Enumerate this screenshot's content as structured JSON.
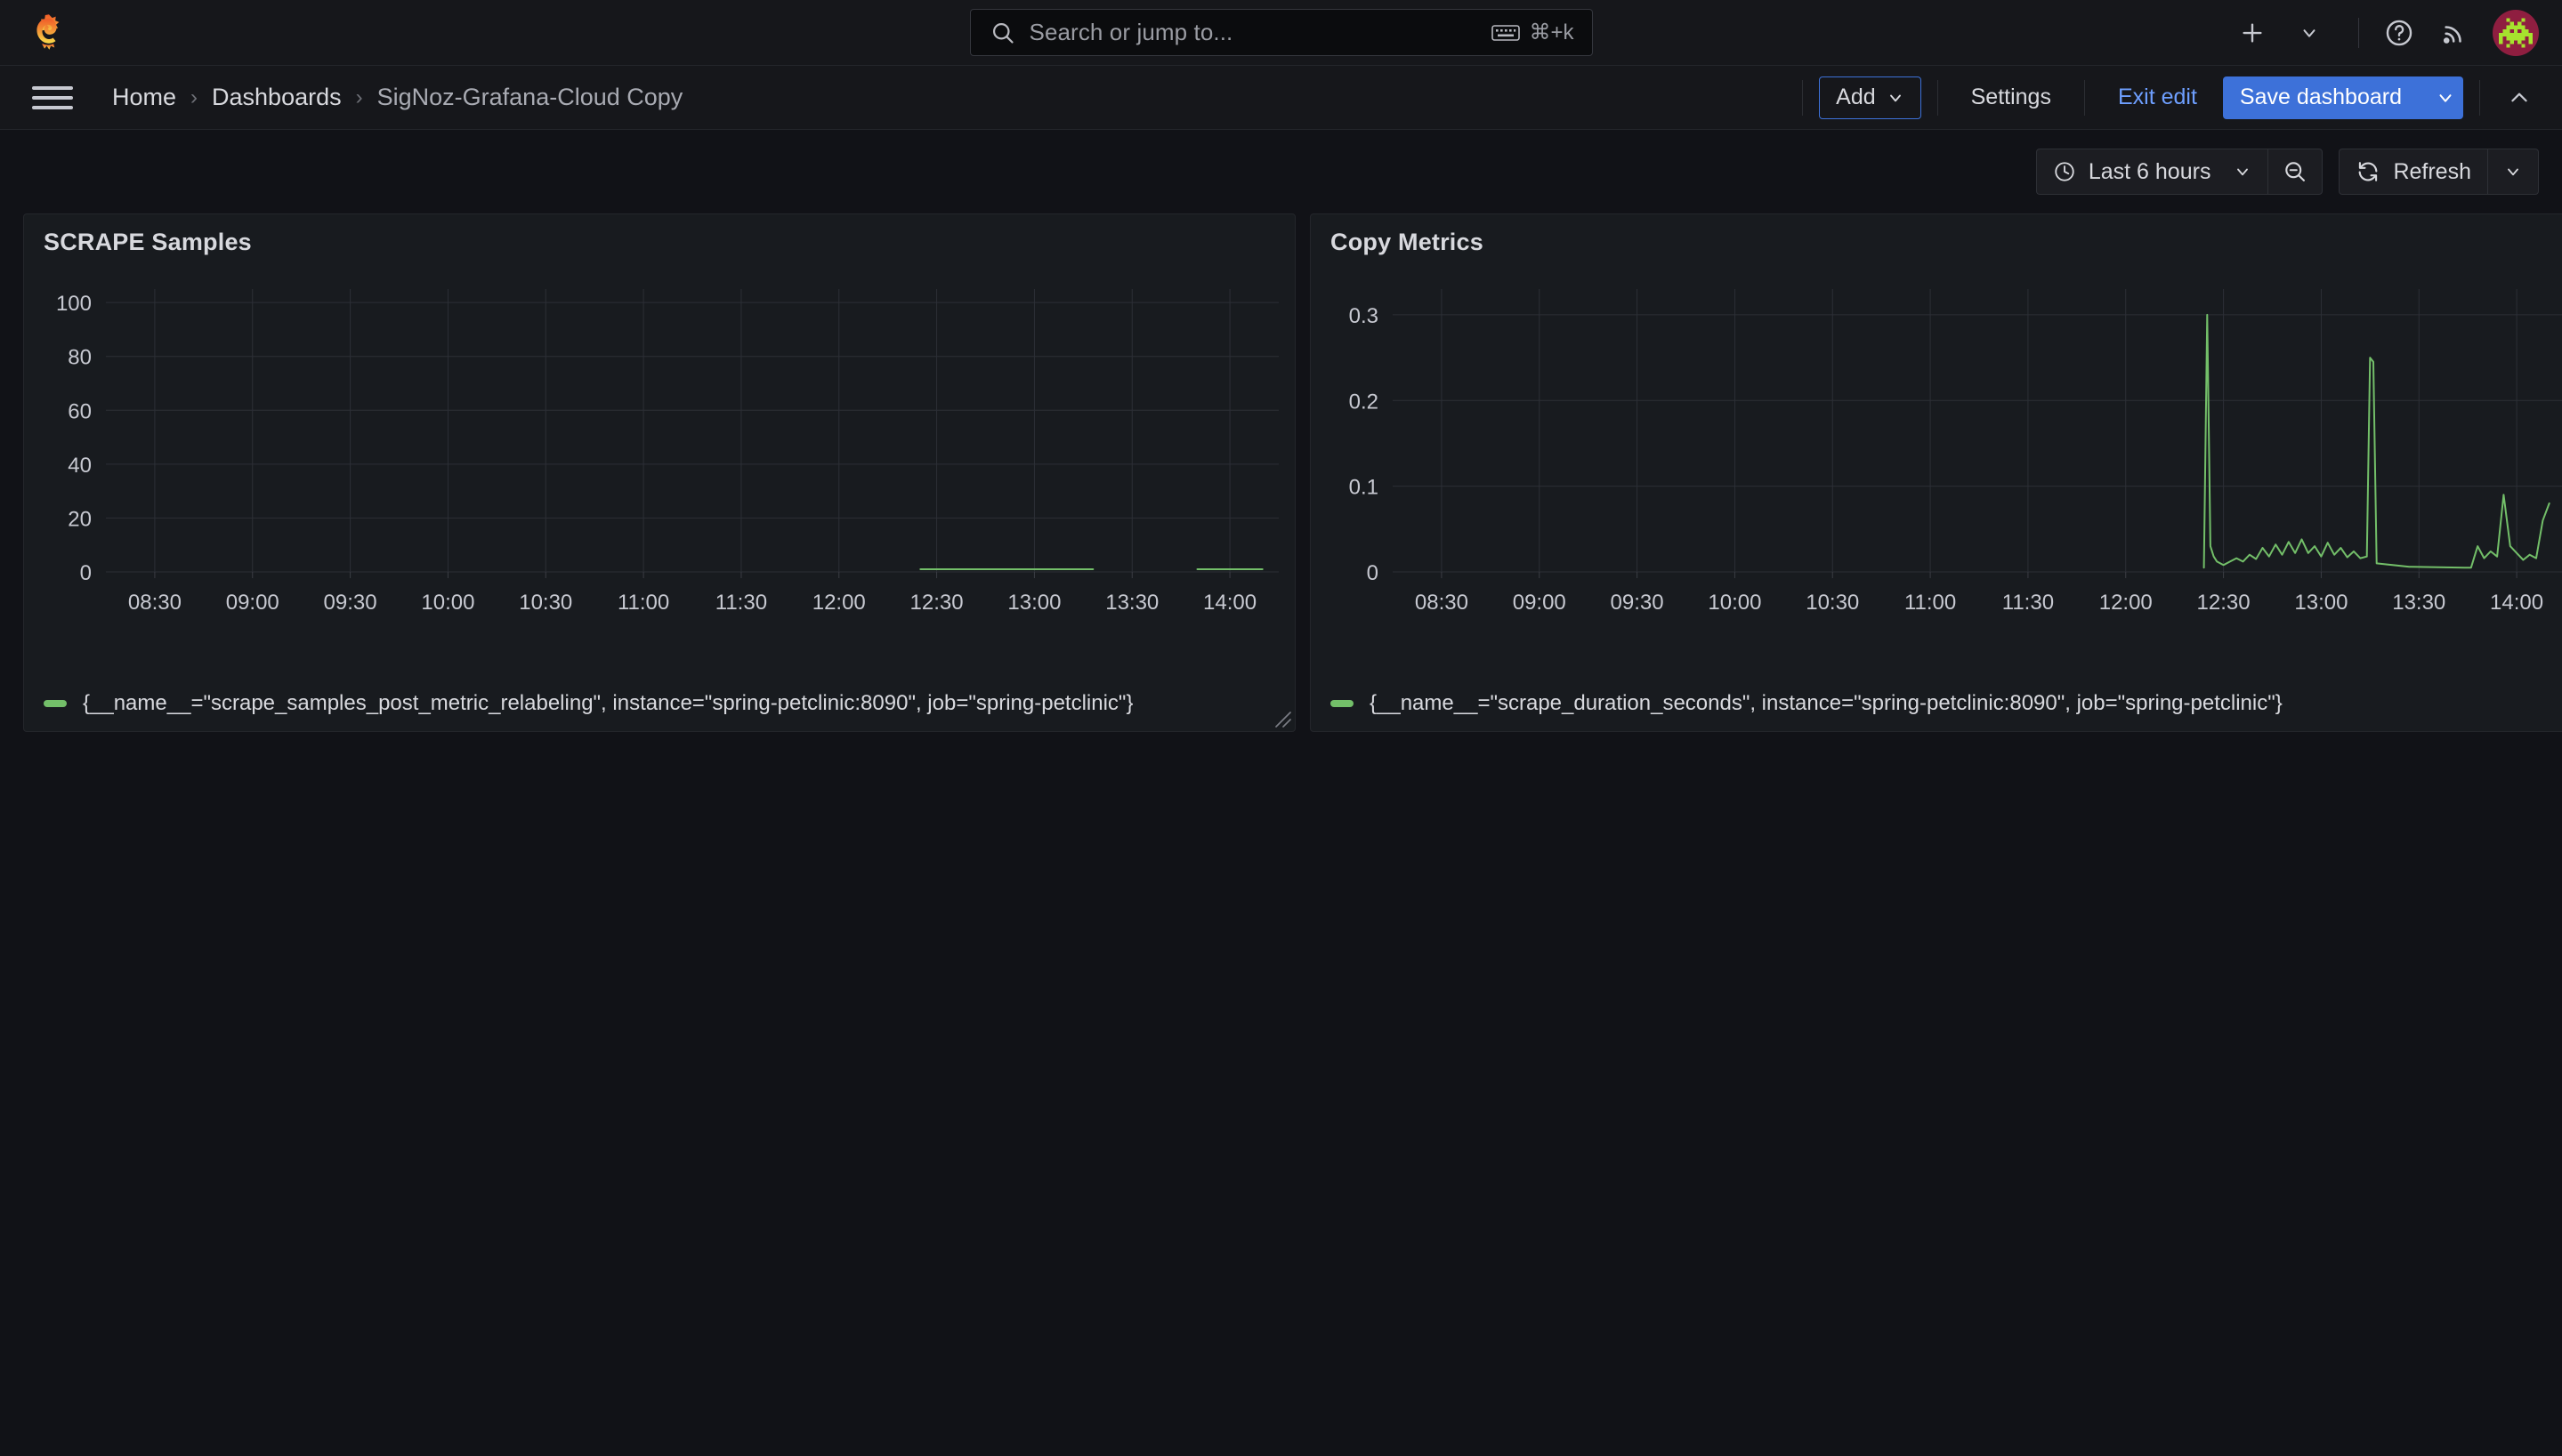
{
  "app": {
    "logo_icon": "grafana-logo-icon",
    "background": "#111217",
    "accent": "#3d71d9",
    "series_color": "#73bf69"
  },
  "search": {
    "placeholder": "Search or jump to...",
    "icon": "search-icon",
    "keyboard_icon": "keyboard-icon",
    "shortcut": "⌘+k"
  },
  "topnav": {
    "add_icon": "plus-icon",
    "add_chevron_icon": "chevron-down-icon",
    "help_icon": "help-circle-icon",
    "news_icon": "rss-icon",
    "avatar_icon": "user-avatar"
  },
  "breadcrumb": {
    "menu_icon": "hamburger-menu-icon",
    "items": [
      {
        "label": "Home"
      },
      {
        "label": "Dashboards"
      },
      {
        "label": "SigNoz-Grafana-Cloud Copy"
      }
    ],
    "separator": "›"
  },
  "toolbar": {
    "add_label": "Add",
    "add_chevron_icon": "chevron-down-icon",
    "settings_label": "Settings",
    "exit_edit_label": "Exit edit",
    "save_label": "Save dashboard",
    "save_chevron_icon": "chevron-down-icon",
    "collapse_icon": "chevron-up-icon"
  },
  "timebar": {
    "clock_icon": "clock-icon",
    "time_range": "Last 6 hours",
    "time_chevron_icon": "chevron-down-icon",
    "zoom_out_icon": "zoom-out-icon",
    "refresh_icon": "refresh-icon",
    "refresh_label": "Refresh",
    "refresh_chevron_icon": "chevron-down-icon"
  },
  "panels": [
    {
      "title": "SCRAPE Samples",
      "legend": "{__name__=\"scrape_samples_post_metric_relabeling\", instance=\"spring-petclinic:8090\", job=\"spring-petclinic\"}",
      "resize_icon": "resize-handle-icon"
    },
    {
      "title": "Copy Metrics",
      "legend": "{__name__=\"scrape_duration_seconds\", instance=\"spring-petclinic:8090\", job=\"spring-petclinic\"}",
      "resize_icon": "resize-handle-icon"
    }
  ],
  "chart_data": [
    {
      "type": "line",
      "title": "SCRAPE Samples",
      "xlabel": "",
      "ylabel": "",
      "grid": true,
      "legend_position": "bottom",
      "series": [
        {
          "name": "{__name__=\"scrape_samples_post_metric_relabeling\", instance=\"spring-petclinic:8090\", job=\"spring-petclinic\"}",
          "color": "#73bf69",
          "x": [
            "12:25",
            "12:30",
            "12:35",
            "12:40",
            "12:45",
            "12:50",
            "12:55",
            "13:00",
            "13:05",
            "13:10",
            "13:15",
            "13:18",
            "13:25",
            "13:27",
            "13:45",
            "13:50",
            "13:55",
            "14:00",
            "14:05",
            "14:10"
          ],
          "values": [
            1,
            1,
            1,
            1,
            1,
            1,
            1,
            1,
            1,
            1,
            1,
            1,
            null,
            1,
            null,
            1,
            1,
            1,
            1,
            1
          ]
        }
      ],
      "xticks": [
        "08:30",
        "09:00",
        "09:30",
        "10:00",
        "10:30",
        "11:00",
        "11:30",
        "12:00",
        "12:30",
        "13:00",
        "13:30",
        "14:00"
      ],
      "yticks": [
        0,
        20,
        40,
        60,
        80,
        100
      ],
      "ylim": [
        0,
        105
      ],
      "xlim": [
        "08:15",
        "14:15"
      ]
    },
    {
      "type": "line",
      "title": "Copy Metrics",
      "xlabel": "",
      "ylabel": "",
      "grid": true,
      "legend_position": "bottom",
      "series": [
        {
          "name": "{__name__=\"scrape_duration_seconds\", instance=\"spring-petclinic:8090\", job=\"spring-petclinic\"}",
          "color": "#73bf69",
          "x": [
            "12:24",
            "12:25",
            "12:26",
            "12:27",
            "12:28",
            "12:30",
            "12:32",
            "12:34",
            "12:36",
            "12:38",
            "12:40",
            "12:42",
            "12:44",
            "12:46",
            "12:48",
            "12:50",
            "12:52",
            "12:54",
            "12:56",
            "12:58",
            "13:00",
            "13:02",
            "13:04",
            "13:06",
            "13:08",
            "13:10",
            "13:12",
            "13:14",
            "13:15",
            "13:16",
            "13:17",
            "13:27",
            "13:28",
            "13:44",
            "13:46",
            "13:48",
            "13:50",
            "13:52",
            "13:54",
            "13:56",
            "13:58",
            "14:00",
            "14:02",
            "14:04",
            "14:06",
            "14:08",
            "14:10"
          ],
          "values": [
            0.005,
            0.3,
            0.03,
            0.018,
            0.012,
            0.008,
            0.012,
            0.016,
            0.012,
            0.02,
            0.015,
            0.028,
            0.018,
            0.032,
            0.02,
            0.035,
            0.022,
            0.038,
            0.022,
            0.03,
            0.018,
            0.034,
            0.02,
            0.028,
            0.017,
            0.024,
            0.016,
            0.018,
            0.25,
            0.245,
            0.01,
            0.006,
            0.006,
            0.005,
            0.005,
            0.03,
            0.016,
            0.024,
            0.018,
            0.09,
            0.03,
            0.022,
            0.014,
            0.02,
            0.016,
            0.06,
            0.08
          ]
        }
      ],
      "xticks": [
        "08:30",
        "09:00",
        "09:30",
        "10:00",
        "10:30",
        "11:00",
        "11:30",
        "12:00",
        "12:30",
        "13:00",
        "13:30",
        "14:00"
      ],
      "yticks": [
        0,
        0.1,
        0.2,
        0.3
      ],
      "ylim": [
        0,
        0.33
      ],
      "xlim": [
        "08:15",
        "14:15"
      ]
    }
  ]
}
